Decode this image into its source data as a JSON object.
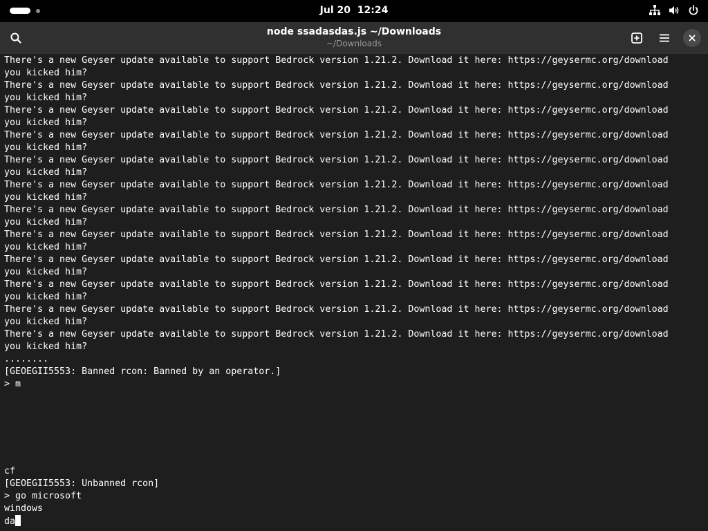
{
  "topbar": {
    "date": "Jul 20",
    "time": "12:24",
    "tray_icons": [
      "network-icon",
      "volume-icon",
      "power-icon"
    ]
  },
  "headerbar": {
    "title": "node ssadasdas.js ~/Downloads",
    "subtitle": "~/Downloads",
    "icons": [
      "search-icon",
      "new-tab-icon",
      "hamburger-menu-icon",
      "close-icon"
    ]
  },
  "terminal": {
    "lines": [
      "There's a new Geyser update available to support Bedrock version 1.21.2. Download it here: https://geysermc.org/download",
      "you kicked him?",
      "There's a new Geyser update available to support Bedrock version 1.21.2. Download it here: https://geysermc.org/download",
      "you kicked him?",
      "There's a new Geyser update available to support Bedrock version 1.21.2. Download it here: https://geysermc.org/download",
      "you kicked him?",
      "There's a new Geyser update available to support Bedrock version 1.21.2. Download it here: https://geysermc.org/download",
      "you kicked him?",
      "There's a new Geyser update available to support Bedrock version 1.21.2. Download it here: https://geysermc.org/download",
      "you kicked him?",
      "There's a new Geyser update available to support Bedrock version 1.21.2. Download it here: https://geysermc.org/download",
      "you kicked him?",
      "There's a new Geyser update available to support Bedrock version 1.21.2. Download it here: https://geysermc.org/download",
      "you kicked him?",
      "There's a new Geyser update available to support Bedrock version 1.21.2. Download it here: https://geysermc.org/download",
      "you kicked him?",
      "There's a new Geyser update available to support Bedrock version 1.21.2. Download it here: https://geysermc.org/download",
      "you kicked him?",
      "There's a new Geyser update available to support Bedrock version 1.21.2. Download it here: https://geysermc.org/download",
      "you kicked him?",
      "There's a new Geyser update available to support Bedrock version 1.21.2. Download it here: https://geysermc.org/download",
      "you kicked him?",
      "There's a new Geyser update available to support Bedrock version 1.21.2. Download it here: https://geysermc.org/download",
      "you kicked him?",
      "........",
      "[GEOEGII5553: Banned rcon: Banned by an operator.]",
      "> m",
      "",
      "",
      "",
      "",
      "",
      "",
      "cf",
      "[GEOEGII5553: Unbanned rcon]",
      "> go microsoft",
      "windows"
    ],
    "input_line": "da"
  }
}
